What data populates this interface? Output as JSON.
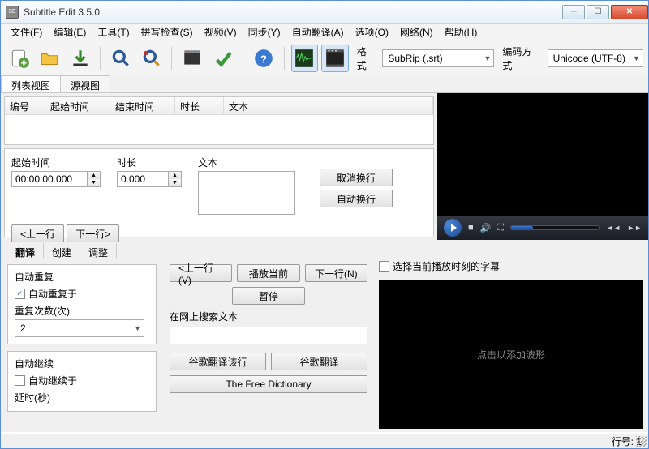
{
  "window": {
    "title": "Subtitle Edit 3.5.0"
  },
  "menu": {
    "file": "文件(F)",
    "edit": "编辑(E)",
    "tools": "工具(T)",
    "spell": "拼写检查(S)",
    "video": "视频(V)",
    "sync": "同步(Y)",
    "autotrans": "自动翻译(A)",
    "options": "选项(O)",
    "network": "网络(N)",
    "help": "帮助(H)"
  },
  "toolbar": {
    "format_label": "格式",
    "format_value": "SubRip (.srt)",
    "encoding_label": "编码方式",
    "encoding_value": "Unicode (UTF-8)"
  },
  "viewtabs": {
    "list": "列表视图",
    "source": "源视图"
  },
  "grid": {
    "num": "编号",
    "start": "起始时间",
    "end": "结束时间",
    "dur": "时长",
    "text": "文本"
  },
  "edit": {
    "start_label": "起始时间",
    "start_value": "00:00:00.000",
    "dur_label": "时长",
    "dur_value": "0.000",
    "text_label": "文本",
    "unbreak": "取消换行",
    "autobreak": "自动换行",
    "prev": "<上一行",
    "next": "下一行>"
  },
  "btabs": {
    "translate": "翻译",
    "create": "创建",
    "adjust": "调整"
  },
  "autorepeat": {
    "section": "自动重复",
    "enable": "自动重复于",
    "count_label": "重复次数(次)",
    "count_value": "2"
  },
  "autocontinue": {
    "section": "自动继续",
    "enable": "自动继续于",
    "delay_label": "延时(秒)"
  },
  "mid": {
    "prev": "<上一行(V)",
    "playcur": "播放当前",
    "next": "下一行(N)",
    "pause": "暂停",
    "search_label": "在网上搜索文本",
    "google_line": "谷歌翻译该行",
    "google": "谷歌翻译",
    "freedict": "The Free Dictionary"
  },
  "wave": {
    "select_current": "选择当前播放时刻的字幕",
    "placeholder": "点击以添加波形"
  },
  "status": {
    "line": "行号: 1"
  }
}
